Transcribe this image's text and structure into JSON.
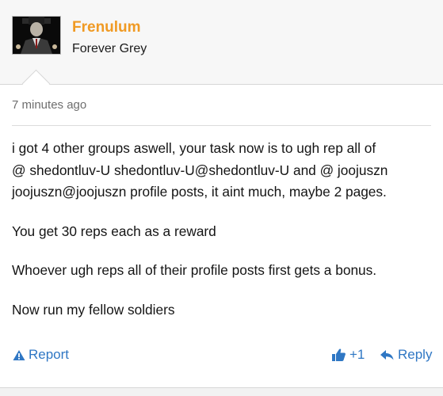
{
  "post": {
    "username": "Frenulum",
    "user_title": "Forever Grey",
    "timestamp": "7 minutes ago",
    "message": [
      "i got 4 other groups aswell, your task now is to ugh rep all of",
      "@ shedontluv-U shedontluv-U@shedontluv-U and @ joojuszn",
      "joojuszn@joojuszn profile posts, it aint much, maybe 2 pages.",
      "You get 30 reps each as a reward",
      "Whoever ugh reps all of their profile posts first gets a bonus.",
      "Now run my fellow soldiers"
    ]
  },
  "actions": {
    "report_label": "Report",
    "like_count": "+1",
    "reply_label": "Reply"
  },
  "colors": {
    "username": "#f09a24",
    "link": "#2f77c4",
    "timestamp": "#6e6e6e"
  },
  "icons": {
    "report": "warning-icon",
    "like": "thumbs-up-icon",
    "reply": "reply-arrow-icon"
  }
}
